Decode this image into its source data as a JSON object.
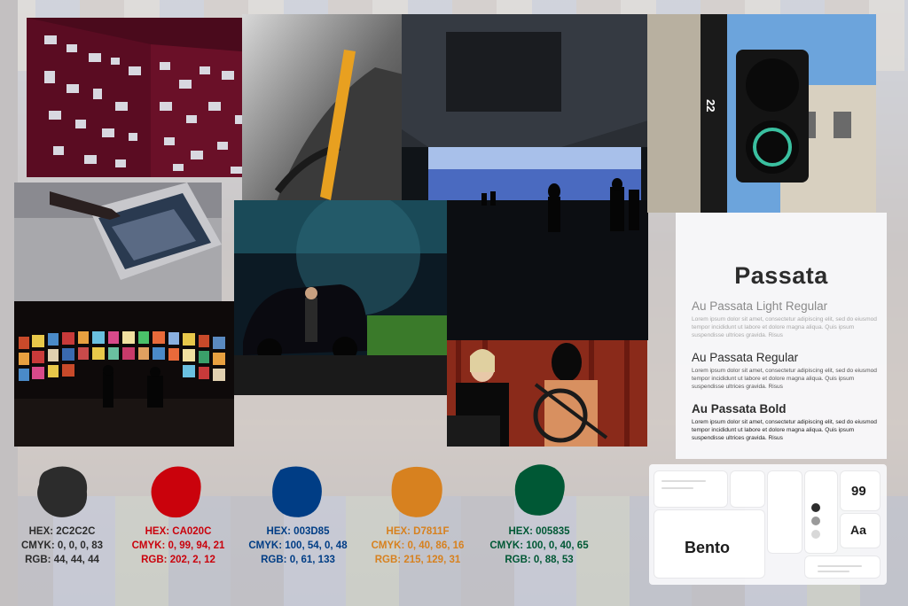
{
  "typography": {
    "title": "Passata",
    "light": {
      "heading": "Au Passata Light Regular",
      "body": "Lorem ipsum dolor sit amet, consectetur adipiscing elit, sed do eiusmod tempor incididunt ut labore et dolore magna aliqua. Quis ipsum suspendisse ultrices gravida. Risus"
    },
    "regular": {
      "heading": "Au Passata Regular",
      "body": "Lorem ipsum dolor sit amet, consectetur adipiscing elit, sed do eiusmod tempor incididunt ut labore et dolore magna aliqua. Quis ipsum suspendisse ultrices gravida. Risus"
    },
    "bold": {
      "heading": "Au Passata Bold",
      "body": "Lorem ipsum dolor sit amet, consectetur adipiscing elit, sed do eiusmod tempor incididunt ut labore et dolore magna aliqua. Quis ipsum suspendisse ultrices gravida. Risus"
    }
  },
  "bento": {
    "label": "Bento",
    "number": "99",
    "sample": "Aa",
    "dot_colors": [
      "#2c2c2c",
      "#9a9a9a",
      "#d8d8d8"
    ]
  },
  "palette": [
    {
      "hex": "HEX: 2C2C2C",
      "cmyk": "CMYK: 0, 0, 0, 83",
      "rgb": "RGB: 44, 44, 44",
      "color": "#2c2c2c"
    },
    {
      "hex": "HEX: CA020C",
      "cmyk": "CMYK: 0, 99, 94, 21",
      "rgb": "RGB: 202, 2, 12",
      "color": "#ca020c"
    },
    {
      "hex": "HEX: 003D85",
      "cmyk": "CMYK: 100, 54, 0, 48",
      "rgb": "RGB: 0, 61, 133",
      "color": "#003d85"
    },
    {
      "hex": "HEX: D7811F",
      "cmyk": "CMYK: 0, 40, 86, 16",
      "rgb": "RGB: 215, 129, 31",
      "color": "#d7811f"
    },
    {
      "hex": "HEX: 005835",
      "cmyk": "CMYK: 100, 0, 40, 65",
      "rgb": "RGB: 0, 88, 53",
      "color": "#005835"
    }
  ],
  "photos": {
    "traffic_light_number": "22"
  }
}
